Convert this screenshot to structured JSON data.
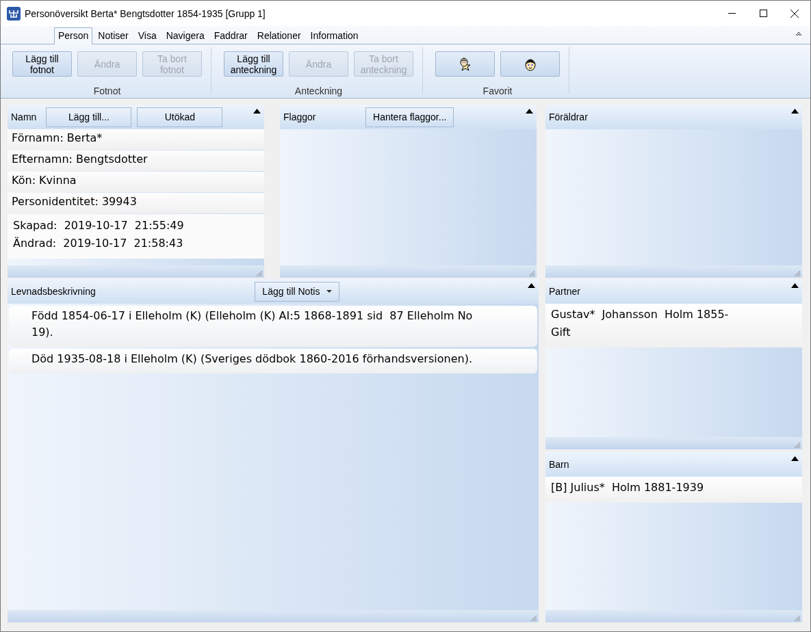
{
  "window": {
    "title": "Personöversikt Berta* Bengtsdotter 1854-1935 [Grupp 1]"
  },
  "ribbon_tabs": [
    {
      "label": "Person",
      "selected": true
    },
    {
      "label": "Notiser",
      "selected": false
    },
    {
      "label": "Visa",
      "selected": false
    },
    {
      "label": "Navigera",
      "selected": false
    },
    {
      "label": "Faddrar",
      "selected": false
    },
    {
      "label": "Relationer",
      "selected": false
    },
    {
      "label": "Information",
      "selected": false
    }
  ],
  "ribbon_groups": [
    {
      "label": "Fotnot",
      "buttons": [
        {
          "kind": "text",
          "label": "Lägg till fotnot",
          "disabled": false
        },
        {
          "kind": "text",
          "label": "Ändra",
          "disabled": true
        },
        {
          "kind": "text",
          "label": "Ta bort fotnot",
          "disabled": true
        }
      ]
    },
    {
      "label": "Anteckning",
      "buttons": [
        {
          "kind": "text",
          "label": "Lägg till anteckning",
          "disabled": false
        },
        {
          "kind": "text",
          "label": "Ändra",
          "disabled": true
        },
        {
          "kind": "text",
          "label": "Ta bort anteckning",
          "disabled": true
        }
      ]
    },
    {
      "label": "Favorit",
      "buttons": [
        {
          "kind": "icon",
          "disabled": false
        },
        {
          "kind": "icon",
          "disabled": false
        }
      ]
    }
  ],
  "name_panel": {
    "title": "Namn",
    "buttons": [
      "Lägg till...",
      "Utökad"
    ],
    "rows": [
      "Förnamn: Berta*",
      "Efternamn: Bengtsdotter",
      "Kön: Kvinna",
      "Personidentitet: 39943"
    ],
    "timestamps": [
      "Skapad:  2019-10-17  21:55:49",
      "Ändrad:  2019-10-17  21:58:43"
    ]
  },
  "flags_panel": {
    "title": "Flaggor",
    "button": "Hantera flaggor..."
  },
  "parents_panel": {
    "title": "Föräldrar"
  },
  "life_panel": {
    "title": "Levnadsbeskrivning",
    "button": "Lägg till Notis",
    "entries": [
      "Född 1854-06-17 i Elleholm (K) (Elleholm (K) AI:5 1868-1891 sid  87 Elleholm No 19).",
      "Död 1935-08-18 i Elleholm (K) (Sveriges dödbok 1860-2016 förhandsversionen)."
    ]
  },
  "partner_panel": {
    "title": "Partner",
    "entries": [
      {
        "name": "Gustav*  Johansson  Holm 1855-",
        "relation": "Gift"
      }
    ]
  },
  "children_panel": {
    "title": "Barn",
    "entries": [
      "[B] Julius*  Holm 1881-1939"
    ]
  }
}
